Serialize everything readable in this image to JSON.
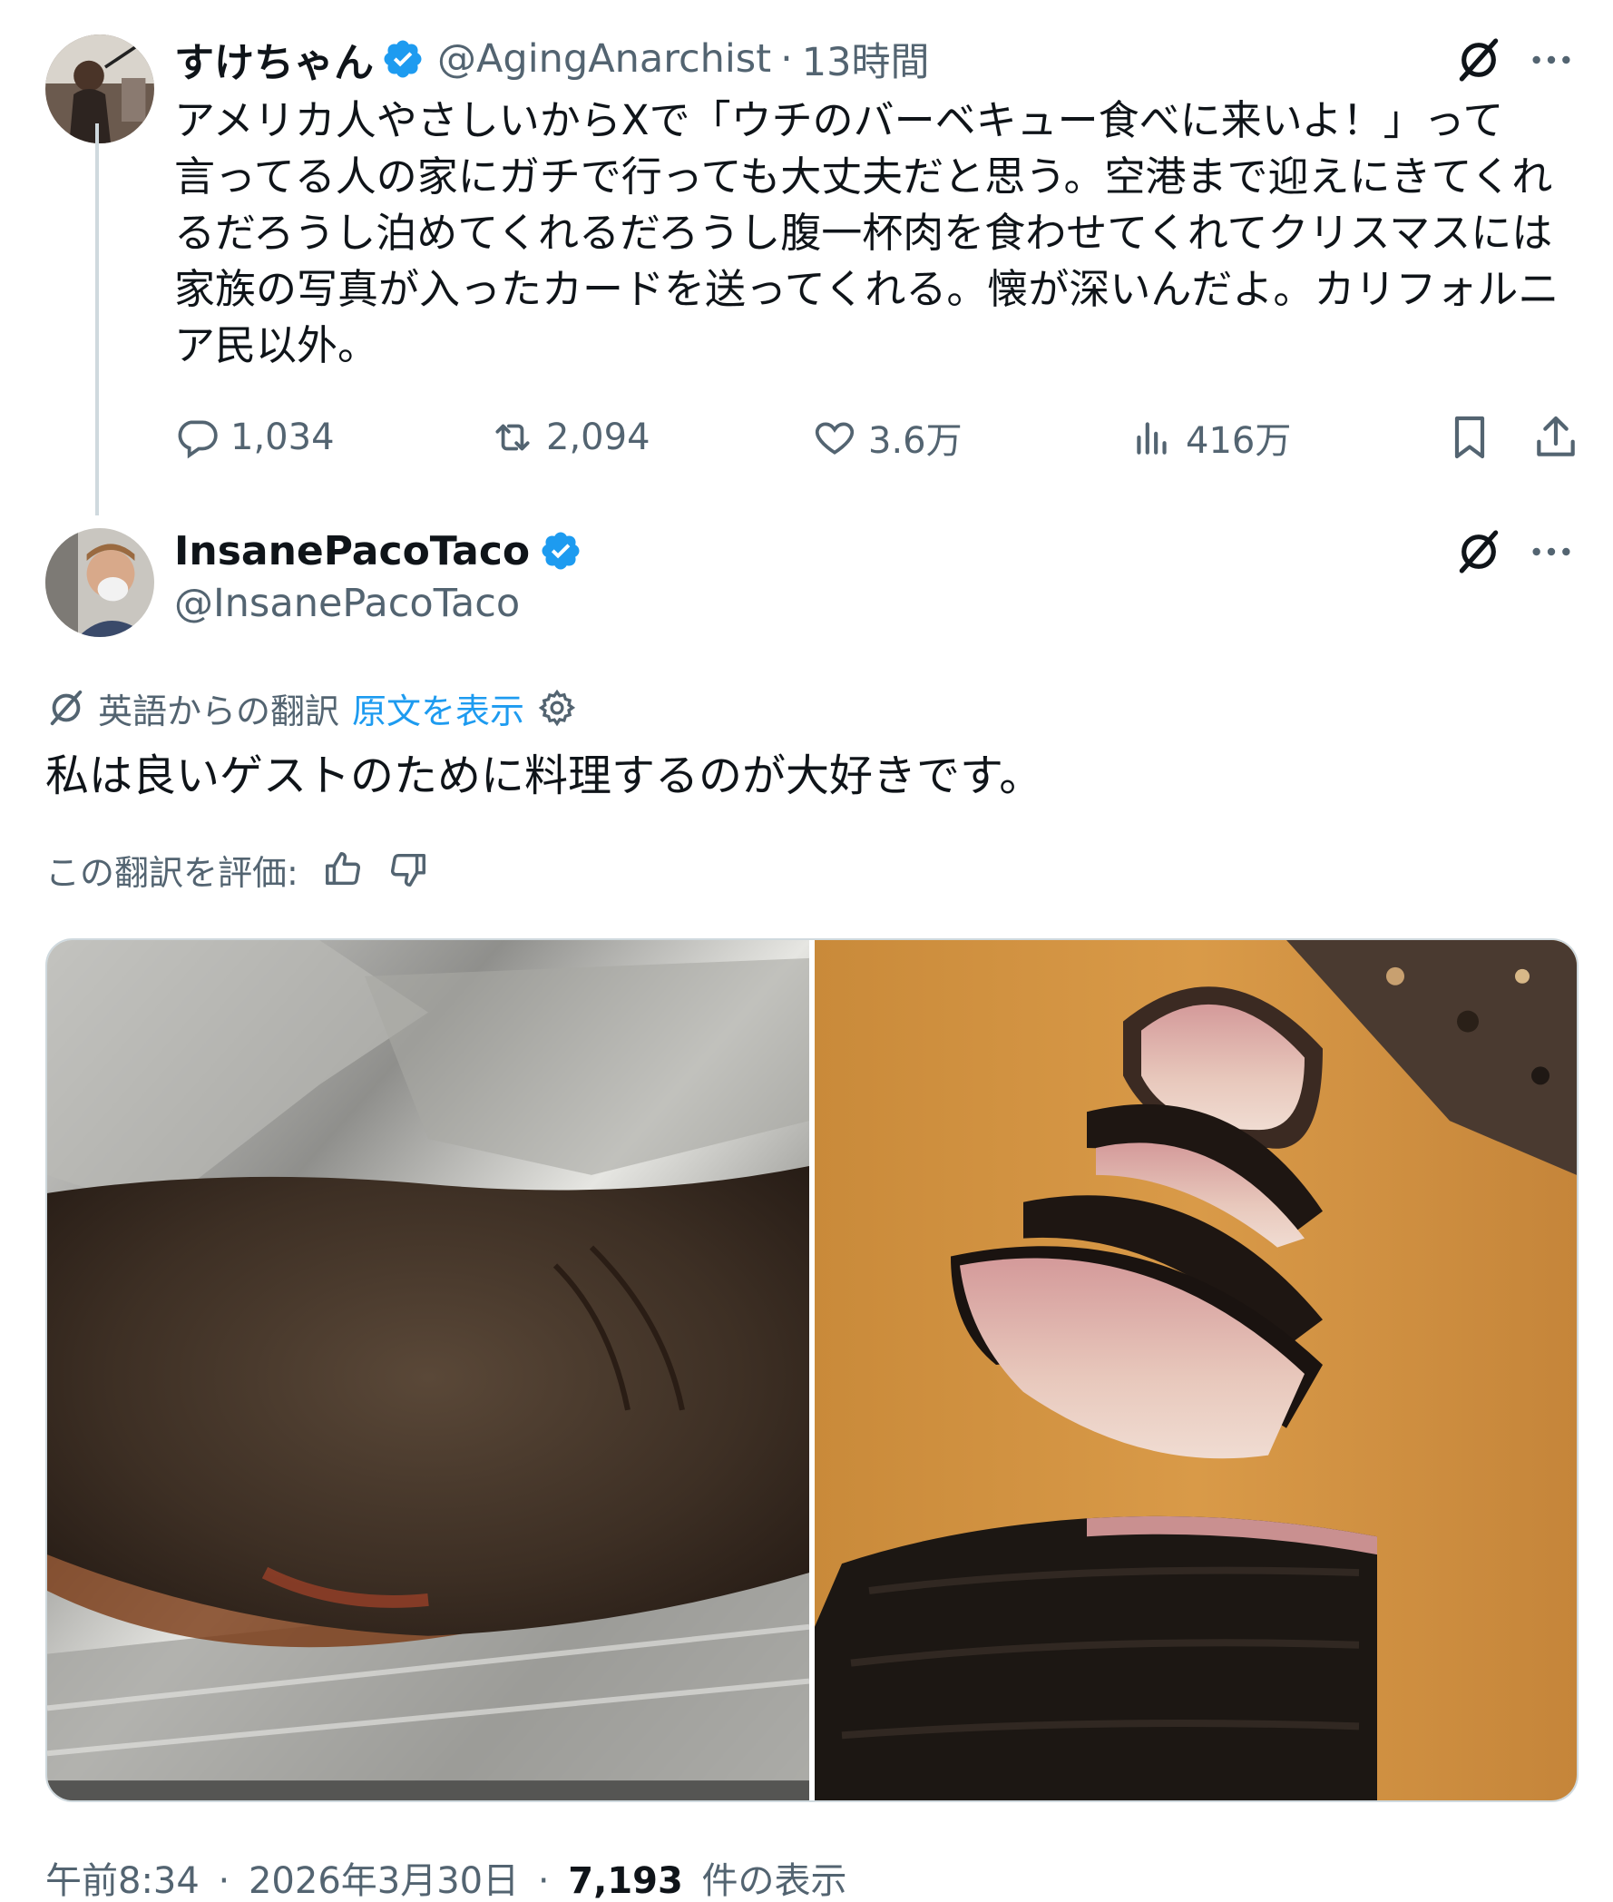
{
  "tweet1": {
    "author_name": "すけちゃん",
    "author_handle": "@AgingAnarchist",
    "separator": "·",
    "time": "13時間",
    "text": "アメリカ人やさしいからXで「ウチのバーベキュー食べに来いよ！」って\n言ってる人の家にガチで行っても大丈夫だと思う。空港まで迎えにきてくれ\nるだろうし泊めてくれるだろうし腹一杯肉を食わせてくれてクリスマスには\n家族の写真が入ったカードを送ってくれる。懐が深いんだよ。カリフォルニ\nア民以外。",
    "replies": "1,034",
    "reposts": "2,094",
    "likes": "3.6万",
    "views": "416万"
  },
  "tweet2": {
    "author_name": "InsanePacoTaco",
    "author_handle": "@InsanePacoTaco",
    "translated_from": "英語からの翻訳",
    "show_original": "原文を表示",
    "text": "私は良いゲストのために料理するのが大好きです。",
    "rate_label": "この翻訳を評価:",
    "time": "午前8:34",
    "dot": "·",
    "date": "2026年3月30日",
    "view_count": "7,193",
    "view_suffix": "件の表示"
  },
  "colors": {
    "text_primary": "#0f1419",
    "text_secondary": "#536471",
    "accent": "#1d9bf0",
    "border": "#cfd9de"
  },
  "icons": [
    "verified-badge-icon",
    "grok-translate-icon",
    "more-icon",
    "reply-icon",
    "repost-icon",
    "like-icon",
    "views-icon",
    "bookmark-icon",
    "share-icon",
    "settings-gear-icon",
    "thumbs-up-icon",
    "thumbs-down-icon"
  ]
}
